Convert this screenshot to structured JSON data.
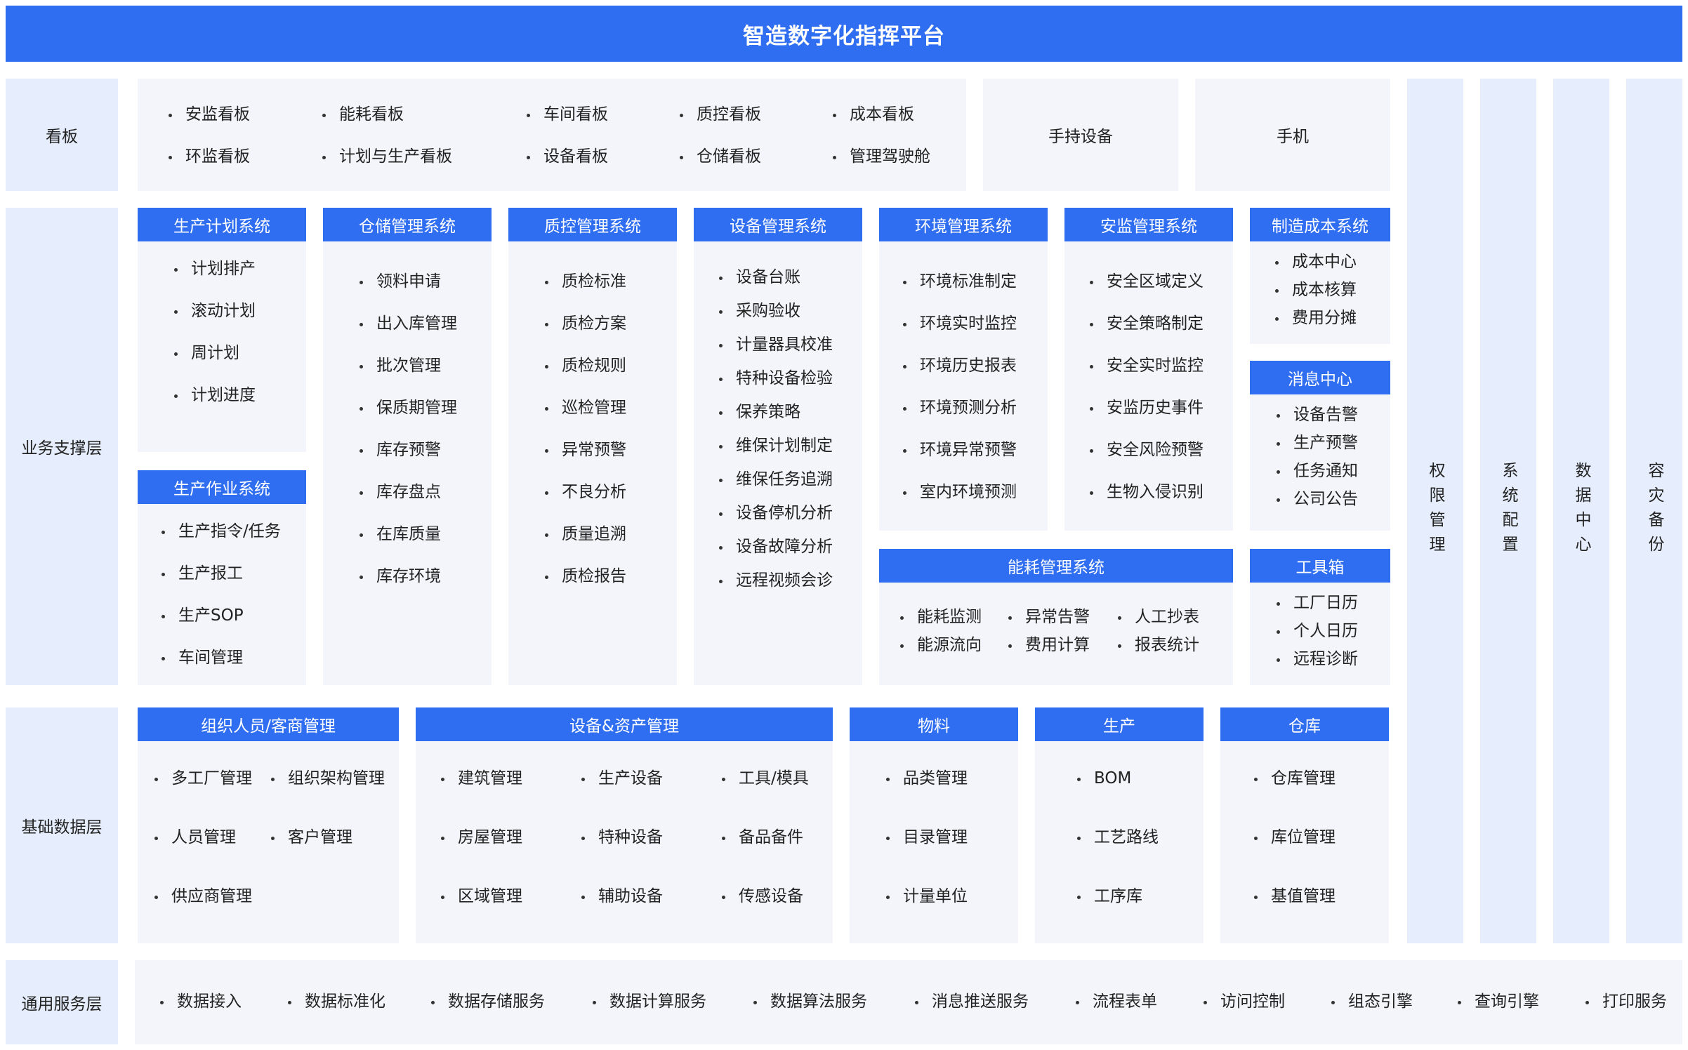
{
  "title": "智造数字化指挥平台",
  "layers": {
    "dashboard": "看板",
    "business": "业务支撑层",
    "foundation": "基础数据层",
    "common": "通用服务层"
  },
  "dashboard": {
    "boards": [
      "安监看板",
      "环监看板",
      "能耗看板",
      "计划与生产看板",
      "车间看板",
      "设备看板",
      "质控看板",
      "仓储看板",
      "成本看板",
      "管理驾驶舱"
    ],
    "handheld": "手持设备",
    "phone": "手机"
  },
  "business": {
    "production_plan": {
      "title": "生产计划系统",
      "items": [
        "计划排产",
        "滚动计划",
        "周计划",
        "计划进度"
      ]
    },
    "production_ops": {
      "title": "生产作业系统",
      "items": [
        "生产指令/任务",
        "生产报工",
        "生产SOP",
        "车间管理"
      ]
    },
    "warehouse": {
      "title": "仓储管理系统",
      "items": [
        "领料申请",
        "出入库管理",
        "批次管理",
        "保质期管理",
        "库存预警",
        "库存盘点",
        "在库质量",
        "库存环境"
      ]
    },
    "quality": {
      "title": "质控管理系统",
      "items": [
        "质检标准",
        "质检方案",
        "质检规则",
        "巡检管理",
        "异常预警",
        "不良分析",
        "质量追溯",
        "质检报告"
      ]
    },
    "equipment": {
      "title": "设备管理系统",
      "items": [
        "设备台账",
        "采购验收",
        "计量器具校准",
        "特种设备检验",
        "保养策略",
        "维保计划制定",
        "维保任务追溯",
        "设备停机分析",
        "设备故障分析",
        "远程视频会诊"
      ]
    },
    "environment": {
      "title": "环境管理系统",
      "items": [
        "环境标准制定",
        "环境实时监控",
        "环境历史报表",
        "环境预测分析",
        "环境异常预警",
        "室内环境预测"
      ]
    },
    "safety": {
      "title": "安监管理系统",
      "items": [
        "安全区域定义",
        "安全策略制定",
        "安全实时监控",
        "安监历史事件",
        "安全风险预警",
        "生物入侵识别"
      ]
    },
    "energy": {
      "title": "能耗管理系统",
      "items": [
        "能耗监测",
        "能源流向",
        "异常告警",
        "费用计算",
        "人工抄表",
        "报表统计"
      ]
    },
    "cost": {
      "title": "制造成本系统",
      "items": [
        "成本中心",
        "成本核算",
        "费用分摊"
      ]
    },
    "message": {
      "title": "消息中心",
      "items": [
        "设备告警",
        "生产预警",
        "任务通知",
        "公司公告"
      ]
    },
    "toolbox": {
      "title": "工具箱",
      "items": [
        "工厂日历",
        "个人日历",
        "远程诊断"
      ]
    }
  },
  "foundation": {
    "org": {
      "title": "组织人员/客商管理",
      "items": [
        "多工厂管理",
        "组织架构管理",
        "人员管理",
        "客户管理",
        "供应商管理"
      ]
    },
    "assets": {
      "title": "设备&资产管理",
      "items": [
        "建筑管理",
        "生产设备",
        "工具/模具",
        "房屋管理",
        "特种设备",
        "备品备件",
        "区域管理",
        "辅助设备",
        "传感设备"
      ]
    },
    "material": {
      "title": "物料",
      "items": [
        "品类管理",
        "目录管理",
        "计量单位"
      ]
    },
    "production": {
      "title": "生产",
      "items": [
        "BOM",
        "工艺路线",
        "工序库"
      ]
    },
    "warehouse": {
      "title": "仓库",
      "items": [
        "仓库管理",
        "库位管理",
        "基值管理"
      ]
    }
  },
  "common": {
    "items": [
      "数据接入",
      "数据标准化",
      "数据存储服务",
      "数据计算服务",
      "数据算法服务",
      "消息推送服务",
      "流程表单",
      "访问控制",
      "组态引擎",
      "查询引擎",
      "打印服务"
    ]
  },
  "side": [
    "权限管理",
    "系统配置",
    "数据中心",
    "容灾备份"
  ]
}
